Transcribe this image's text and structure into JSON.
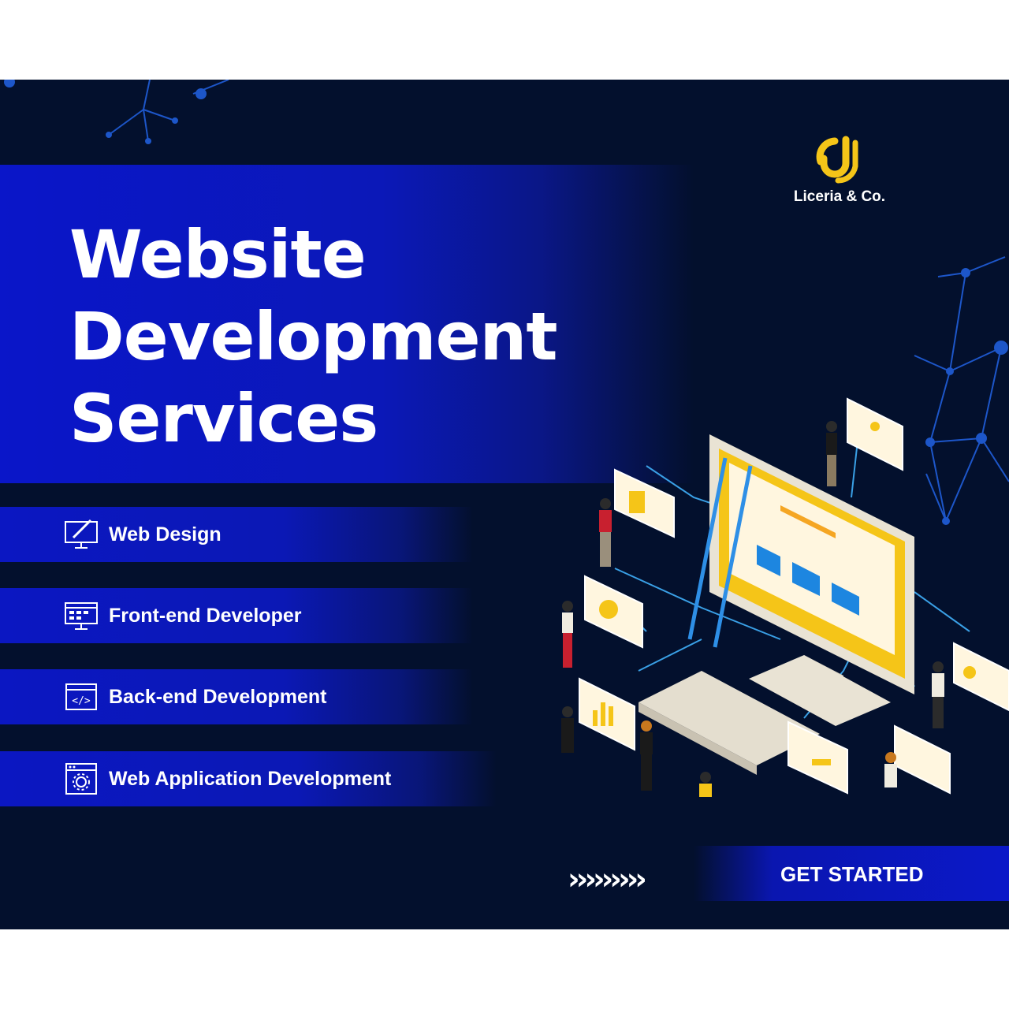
{
  "colors": {
    "background": "#03102d",
    "band_blue": "#0b18c2",
    "accent_yellow": "#f5c518",
    "text": "#ffffff"
  },
  "hero": {
    "title_lines": [
      "Website",
      "Development",
      "Services"
    ]
  },
  "brand": {
    "name": "Liceria & Co.",
    "icon": "brand-logo-icon"
  },
  "services": [
    {
      "label": "Web Design",
      "icon": "design-monitor-brush-icon"
    },
    {
      "label": "Front-end Developer",
      "icon": "frontend-monitor-icon"
    },
    {
      "label": "Back-end Development",
      "icon": "code-window-icon"
    },
    {
      "label": "Web Application Development",
      "icon": "app-gear-window-icon"
    }
  ],
  "cta": {
    "arrows": "›››››››››",
    "label": "GET STARTED"
  }
}
